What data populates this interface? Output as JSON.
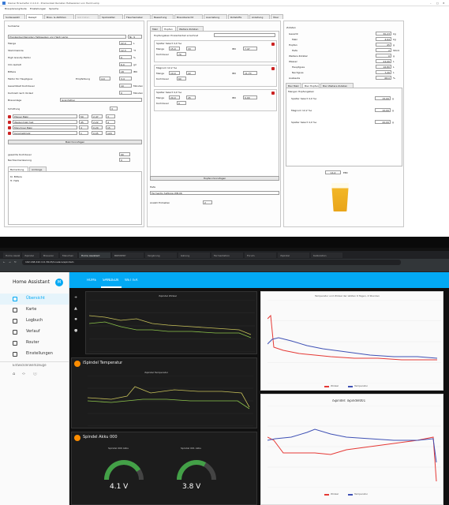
{
  "brew_window": {
    "title": "Kleiner Brauhelfer 2.4.0.0 - Prankenbeil Reinsten Hefeweizen von Heidi Lamp",
    "menu": [
      "Brauplanung/Sude",
      "Einstellungen",
      "Sprache"
    ],
    "main_tabs": [
      "Sudauswahl",
      "Rezept",
      "Brau- & Abfüllen",
      "Gär-Daten",
      "Spickzettel",
      "Flaschenlabel",
      "Bewertung",
      "Brauübersicht",
      "Ausrüstung",
      "Rohstoffe",
      "Anleitung",
      "Über"
    ],
    "recipe": {
      "name": "Prankenbeil Reinsten Hefeweizen von Heidi Lamp",
      "number": "Nr. 9",
      "fields": [
        {
          "label": "Menge",
          "value": "22,0",
          "unit": "L"
        },
        {
          "label": "Stammwürze",
          "value": "12,3",
          "unit": "°P"
        },
        {
          "label": "High Gravity-Faktor",
          "value": "0",
          "unit": "%"
        },
        {
          "label": "CO₂-Gehalt",
          "value": "6,0",
          "unit": "g/l"
        },
        {
          "label": "Bittere",
          "value": "18",
          "unit": "IBU"
        },
        {
          "label": "Faktor für Hauptguss",
          "value": "3,4",
          "unit": ""
        },
        {
          "label": "Gesamtzeit Kochdauer",
          "value": "10",
          "unit": "Minuten"
        },
        {
          "label": "Kochzeit nach Vorlauf",
          "value": "0",
          "unit": "Minuten"
        }
      ],
      "hops_factor_label": "Empfehlung",
      "hops_factor_value": "4,0",
      "brewhouse_label": "Brauanlage",
      "brewhouse_value": "Grainfather"
    },
    "malts": {
      "header": "Schüttung",
      "count": "3",
      "rows": [
        {
          "name": "Pilsner Malz",
          "pct": "50",
          "kg": "2,47",
          "ebc": "3"
        },
        {
          "name": "Weizenmalz hell",
          "pct": "45",
          "kg": "2,22",
          "ebc": "4"
        },
        {
          "name": "Münchner Malz",
          "pct": "4",
          "kg": "0,20",
          "ebc": "15"
        },
        {
          "name": "Karamellmalz",
          "pct": "1",
          "kg": "0,05",
          "ebc": "120"
        }
      ],
      "add_label": "Malz hinzufügen"
    },
    "hops_total": {
      "total_label": "gesamte Kochdauer",
      "total_value": "90",
      "later_label": "Nachisomerisierung",
      "later_value": "0"
    },
    "comment_tabs": [
      "Bemerkung",
      "Anhänge"
    ],
    "comment_text": [
      "Kl. Bittere",
      "Tr. Hefe"
    ],
    "hop_tabs": [
      "Malz",
      "Hopfen",
      "Weitere Zutaten"
    ],
    "hop_group": {
      "calc_label": "Hopfengaben Prozentanteil errechnet",
      "hops": [
        {
          "name": "Spalter Select 4,0 %α",
          "amount": "15,0",
          "pct": "33",
          "time": "70",
          "ibu": "7,47"
        },
        {
          "name": "Magnum 12,2 %α",
          "amount": "10,0",
          "pct": "22",
          "time": "60",
          "ibu": "11,70"
        },
        {
          "name": "Spalter Select 4,0 %α",
          "amount": "20,0",
          "pct": "45",
          "time": "0",
          "ibu": "0,00"
        }
      ],
      "add_label": "Hopfen hinzufügen"
    },
    "yeast": {
      "header": "Hefe",
      "value": "Fermentis Safbrew WB-06",
      "units_label": "Anzahl Einheiten",
      "units_value": "2"
    },
    "summary": {
      "header": "Zutaten",
      "rows": [
        {
          "label": "Gesamt",
          "value": "30,23",
          "unit": "kg"
        },
        {
          "label": "Malz",
          "value": "4,94",
          "unit": "kg"
        },
        {
          "label": "Hopfen",
          "value": "45",
          "unit": "g"
        },
        {
          "label": "Hefe",
          "value": "2",
          "unit": "Stück"
        },
        {
          "label": "Weitere Zutaten",
          "value": "0",
          "unit": "g"
        },
        {
          "label": "Wasser",
          "value": "24,06",
          "unit": "L"
        },
        {
          "label": "Hauptguss",
          "value": "16,80",
          "unit": "L"
        },
        {
          "label": "Nachguss",
          "value": "7,26",
          "unit": "L"
        },
        {
          "label": "Ausbeute",
          "value": "68,0",
          "unit": "%"
        }
      ]
    },
    "summary_tabs": [
      "Bier Malz",
      "Bier Hopfen",
      "Bier Weitere Zutaten"
    ],
    "hop_summary": {
      "header": "Mengen Hopfengaben",
      "rows": [
        {
          "label": "Spalter Select 4,0 %α",
          "value": "15,00",
          "unit": "g"
        },
        {
          "label": "Magnum 12,2 %α",
          "value": "10,00",
          "unit": "g"
        },
        {
          "label": "Spalter Select 4,0 %α",
          "value": "20,00",
          "unit": "g"
        }
      ]
    },
    "color_value": "14,4",
    "color_unit": "EBC"
  },
  "browser": {
    "tabs": [
      "Home Assistant",
      "iSpindel",
      "Brauerei",
      "Maischen",
      "BREWERY",
      "Vergärung",
      "Home Assistant",
      "Gärung",
      "Fermentation",
      "Forum",
      "iSpindel",
      "Kalkulation"
    ],
    "url": "192.168.242.111:8123/lovelace/spindeln"
  },
  "ha": {
    "title": "Home Assistant",
    "avatar": "M",
    "nav": [
      {
        "label": "Übersicht",
        "icon": "dashboard-icon"
      },
      {
        "label": "Karte",
        "icon": "map-icon"
      },
      {
        "label": "Logbuch",
        "icon": "logbook-icon"
      },
      {
        "label": "Verlauf",
        "icon": "history-icon"
      },
      {
        "label": "Router",
        "icon": "router-icon"
      },
      {
        "label": "Einstellungen",
        "icon": "settings-icon"
      }
    ],
    "dev_tools_label": "Entwicklerwerkzeuge",
    "view_tabs": [
      "HOME",
      "SPINDELN",
      "WETTER"
    ],
    "cards": {
      "winkel": {
        "title": "iSpindel Winkel"
      },
      "temp_header": "iSpindel Temperatur",
      "temp": {
        "title": "iSpindel Temperatur"
      },
      "akku_header": "Spindel Akku 000",
      "gauges": [
        {
          "title": "Spindel 000 Akku",
          "value": "4.1 V",
          "level": 0.82
        },
        {
          "title": "Spindel 001 Akku",
          "value": "3.8 V",
          "level": 0.66
        }
      ]
    },
    "right_charts": [
      {
        "title": "Temperatur und Winkel der letzten 6 Tagen, 4 Stunden",
        "legend": [
          "Winkel",
          "Temperatur"
        ]
      },
      {
        "title": "iSpindel: iSpindel001",
        "legend": [
          "Winkel",
          "Temperatur"
        ]
      }
    ]
  },
  "colors": {
    "ha_blue": "#03a9f4",
    "winkel": "#e53935",
    "temperatur": "#3f51b5",
    "gauge_green": "#43a047",
    "gauge_orange": "#fb8c00",
    "beer": "#f2b627"
  }
}
